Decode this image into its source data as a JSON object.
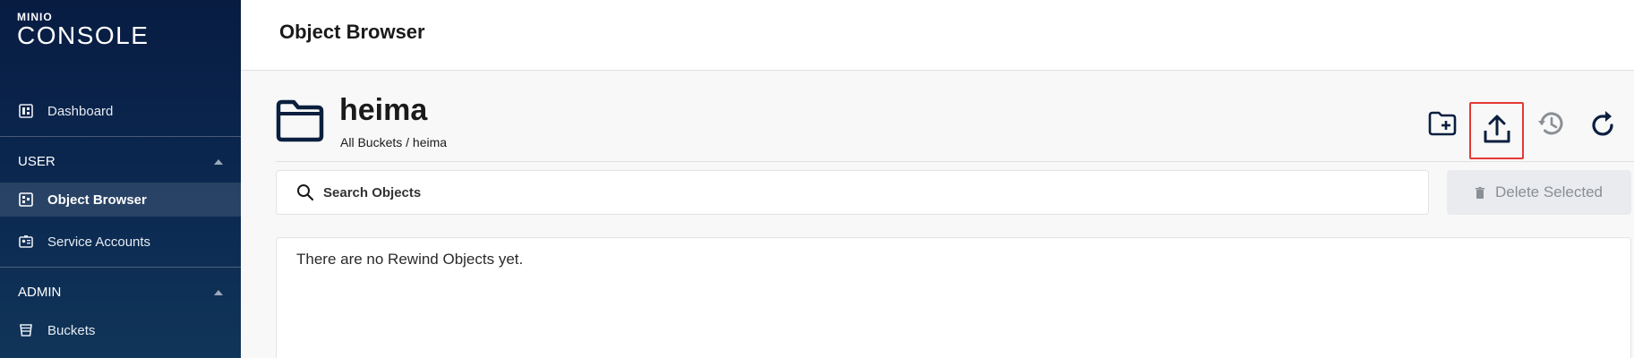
{
  "app": {
    "logo_top": "MINIO",
    "logo_main": "CONSOLE"
  },
  "sidebar": {
    "dashboard": "Dashboard",
    "section_user": "USER",
    "object_browser": "Object Browser",
    "service_accounts": "Service Accounts",
    "section_admin": "ADMIN",
    "buckets": "Buckets"
  },
  "header": {
    "title": "Object Browser"
  },
  "bucket": {
    "name": "heima",
    "breadcrumb": "All Buckets / heima"
  },
  "toolbar": {
    "icons": [
      "create-folder-icon",
      "upload-icon",
      "rewind-icon",
      "refresh-icon"
    ],
    "highlighted": "upload-icon",
    "highlight_color": "#e53935"
  },
  "search": {
    "placeholder": "Search Objects",
    "value": ""
  },
  "actions": {
    "delete_selected": "Delete Selected"
  },
  "content": {
    "empty_message": "There are no Rewind Objects yet."
  },
  "colors": {
    "sidebar_bg": "#0c2a52",
    "accent": "#081c42"
  }
}
